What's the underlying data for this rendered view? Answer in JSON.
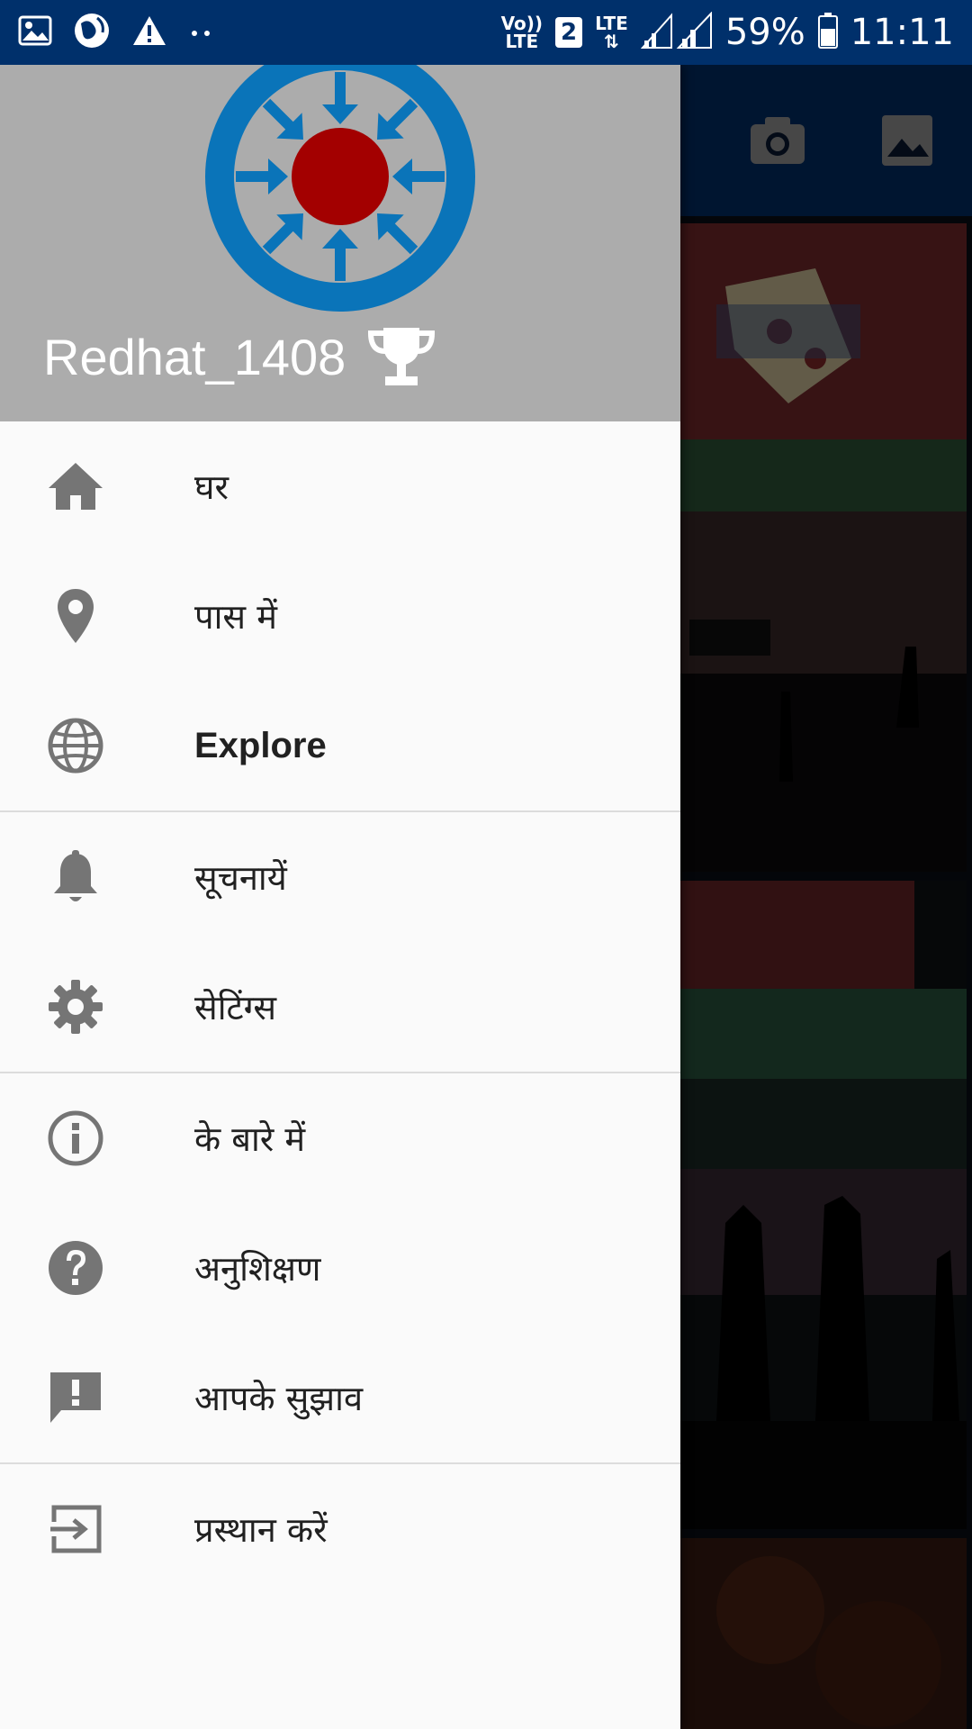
{
  "status_bar": {
    "network_volte": "Vo))",
    "network_lte": "LTE",
    "sim": "2",
    "lte": "LTE",
    "battery": "59%",
    "time": "11:11",
    "icons": [
      "image-icon",
      "globe-sync-icon",
      "warning-icon",
      "more-dots-icon",
      "signal-icon",
      "battery-icon"
    ]
  },
  "toolbar": {
    "icons": [
      "camera-icon",
      "gallery-icon"
    ]
  },
  "drawer": {
    "username": "Redhat_1408",
    "groups": [
      [
        {
          "icon": "home-icon",
          "label": "घर",
          "bold": false
        },
        {
          "icon": "location-pin-icon",
          "label": "पास में",
          "bold": false
        },
        {
          "icon": "globe-icon",
          "label": "Explore",
          "bold": true
        }
      ],
      [
        {
          "icon": "bell-icon",
          "label": "सूचनायें",
          "bold": false
        },
        {
          "icon": "gear-icon",
          "label": "सेटिंग्स",
          "bold": false
        }
      ],
      [
        {
          "icon": "info-icon",
          "label": "के बारे में",
          "bold": false
        },
        {
          "icon": "help-icon",
          "label": "अनुशिक्षण",
          "bold": false
        },
        {
          "icon": "feedback-icon",
          "label": "आपके सुझाव",
          "bold": false
        }
      ],
      [
        {
          "icon": "logout-icon",
          "label": "प्रस्थान करें",
          "bold": false
        }
      ]
    ]
  },
  "colors": {
    "status_bar": "#00306b",
    "drawer_header": "#acacac",
    "logo_blue": "#0a74b9",
    "logo_red": "#a30000",
    "icon_grey": "#757575"
  }
}
